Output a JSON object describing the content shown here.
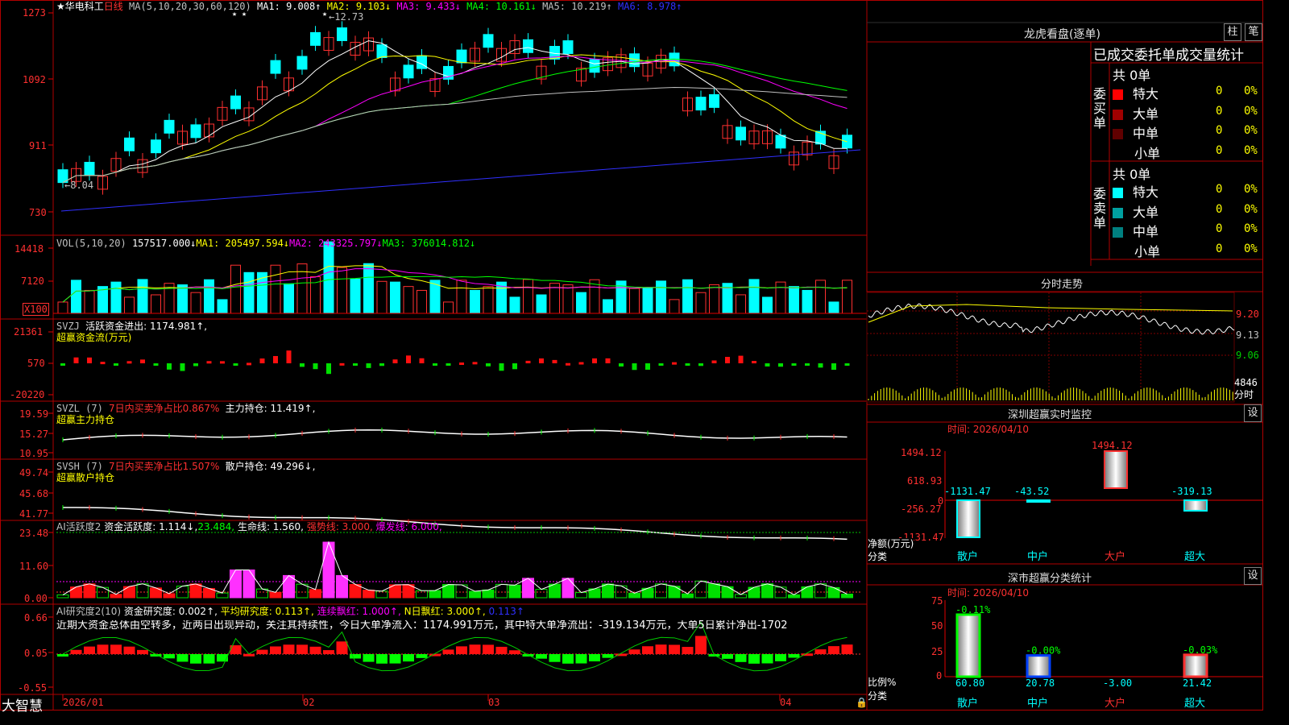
{
  "stock": {
    "star": "★",
    "name": "华电科工",
    "period": "日线"
  },
  "ma_header": {
    "label": "MA(5,10,20,30,60,120)",
    "items": [
      {
        "text": "MA1: 9.008↑",
        "color": "#ffffff"
      },
      {
        "text": "MA2: 9.103↓",
        "color": "#ffff00"
      },
      {
        "text": "MA3: 9.433↓",
        "color": "#ff00ff"
      },
      {
        "text": "MA4: 10.161↓",
        "color": "#00ff00"
      },
      {
        "text": "MA5: 10.219↑",
        "color": "#c0c0c0"
      },
      {
        "text": "MA6: 8.978↑",
        "color": "#3030ff"
      }
    ],
    "high_mark": "12.73",
    "low_mark": "8.04"
  },
  "price_axis": [
    "1273",
    "1092",
    "911",
    "730"
  ],
  "vol_header": {
    "label": "VOL(5,10,20)",
    "items": [
      {
        "text": "157517.000↓",
        "color": "#ffffff"
      },
      {
        "text": "MA1: 205497.594↓",
        "color": "#ffff00"
      },
      {
        "text": "MA2: 243325.797↓",
        "color": "#ff00ff"
      },
      {
        "text": "MA3: 376014.812↓",
        "color": "#00ff00"
      }
    ]
  },
  "vol_axis": [
    "14418",
    "7120",
    "X100"
  ],
  "svzj": {
    "label": "SVZJ",
    "text1": "活跃资金进出: 1174.981↑,",
    "text2": "超赢资金流(万元)",
    "axis": [
      "21361",
      "570",
      "-20220"
    ]
  },
  "svzl": {
    "label": "SVZL (7)",
    "text1": "7日内买卖净占比0.867%",
    "text2": "主力持仓: 11.419↑,",
    "text3": "超赢主力持仓",
    "axis": [
      "19.59",
      "15.27",
      "10.95"
    ]
  },
  "svsh": {
    "label": "SVSH (7)",
    "text1": "7日内买卖净占比1.507%",
    "text2": "散户持仓: 49.296↓,",
    "text3": "超赢散户持仓",
    "axis": [
      "49.74",
      "45.68",
      "41.77"
    ]
  },
  "ai_active": {
    "label": "AI活跃度2",
    "items": [
      {
        "text": "资金活跃度: 1.114↓,",
        "color": "#ffffff"
      },
      {
        "text": "23.484,",
        "color": "#00ff00"
      },
      {
        "text": "生命线: 1.560,",
        "color": "#ffffff"
      },
      {
        "text": "强势线: 3.000,",
        "color": "#ff3030"
      },
      {
        "text": "爆发线: 6.000,",
        "color": "#ff00ff"
      }
    ],
    "axis": [
      "23.48",
      "11.60",
      "0.00"
    ]
  },
  "ai_research": {
    "label": "AI研究度2(10)",
    "items": [
      {
        "text": "资金研究度: 0.002↑,",
        "color": "#ffffff"
      },
      {
        "text": "平均研究度: 0.113↑,",
        "color": "#ffff00"
      },
      {
        "text": "连续飘红: 1.000↑,",
        "color": "#ff00ff"
      },
      {
        "text": "N日飘红: 3.000↑,",
        "color": "#ffff00"
      },
      {
        "text": "0.113↑",
        "color": "#3030ff"
      }
    ],
    "comment": "近期大资金总体由空转多，近两日出现异动，关注其持续性，今日大单净流入：1174.991万元，其中特大单净流出：-319.134万元，大单5日累计净出-1702",
    "axis": [
      "0.66",
      "0.05",
      "-0.55"
    ]
  },
  "date_axis": [
    "2026/01",
    "02",
    "03",
    "04"
  ],
  "brand": "大智慧",
  "dragon": {
    "title": "龙虎看盘(逐单)",
    "btn_bar": "柱",
    "btn_pen": "笔",
    "tabs": [
      "已成交委托单成交量统计"
    ],
    "buy": {
      "side_label": "委买单",
      "total": "共 0单",
      "rows": [
        {
          "label": "特大",
          "color": "#ff0000",
          "count": "0",
          "pct": "0%"
        },
        {
          "label": "大单",
          "color": "#a00000",
          "count": "0",
          "pct": "0%"
        },
        {
          "label": "中单",
          "color": "#600000",
          "count": "0",
          "pct": "0%"
        },
        {
          "label": "小单",
          "color": "#000000",
          "count": "0",
          "pct": "0%"
        }
      ]
    },
    "sell": {
      "side_label": "委卖单",
      "total": "共 0单",
      "rows": [
        {
          "label": "特大",
          "color": "#00ffff",
          "count": "0",
          "pct": "0%"
        },
        {
          "label": "大单",
          "color": "#00a0a0",
          "count": "0",
          "pct": "0%"
        },
        {
          "label": "中单",
          "color": "#008080",
          "count": "0",
          "pct": "0%"
        },
        {
          "label": "小单",
          "color": "#000000",
          "count": "0",
          "pct": "0%"
        }
      ]
    }
  },
  "intraday": {
    "title": "分时走势",
    "axis": [
      "9.20",
      "9.13",
      "9.06"
    ],
    "vol_axis": [
      "4846",
      "分时"
    ]
  },
  "sz_monitor": {
    "title": "深圳超赢实时监控",
    "btn": "设",
    "time": "时间: 2026/04/10",
    "axis": [
      "1494.12",
      "618.93",
      "0",
      "-256.27",
      "-1131.47"
    ],
    "ylabel": "净额(万元)",
    "xlabel": "分类",
    "bars": [
      {
        "cat": "散户",
        "value": -1131.47,
        "label": "-1131.47"
      },
      {
        "cat": "中户",
        "value": -43.52,
        "label": "-43.52"
      },
      {
        "cat": "大户",
        "value": 1494.12,
        "label": "1494.12"
      },
      {
        "cat": "超大",
        "value": -319.13,
        "label": "-319.13"
      }
    ]
  },
  "sz_class": {
    "title": "深市超赢分类统计",
    "btn": "设",
    "time": "时间: 2026/04/10",
    "axis": [
      "75",
      "50",
      "25",
      "0"
    ],
    "ylabel": "比例%",
    "xlabel": "分类",
    "bars": [
      {
        "cat": "散户",
        "value": 60.8,
        "top": "-0.11%",
        "label": "60.80"
      },
      {
        "cat": "中户",
        "value": 20.78,
        "top": "-0.00%",
        "label": "20.78"
      },
      {
        "cat": "大户",
        "value": -3.0,
        "top": "",
        "label": "-3.00"
      },
      {
        "cat": "超大",
        "value": 21.42,
        "top": "-0.03%",
        "label": "21.42"
      }
    ]
  }
}
